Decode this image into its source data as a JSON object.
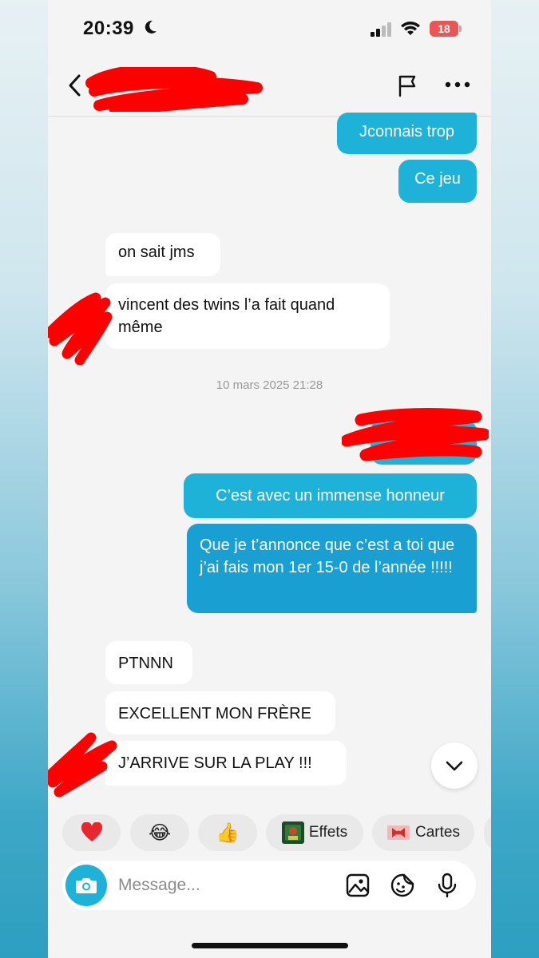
{
  "status_bar": {
    "time": "20:39",
    "battery": "18",
    "moon": "moon-icon",
    "signal": "cellular-signal-icon",
    "wifi": "wifi-icon"
  },
  "header": {
    "back_icon": "chevron-left-icon",
    "flag_icon": "flag-icon",
    "more_icon": "more-dots-icon"
  },
  "messages": [
    {
      "side": "out",
      "text": "Jconnais trop"
    },
    {
      "side": "out",
      "text": "Ce jeu"
    },
    {
      "side": "in",
      "text": "on sait jms"
    },
    {
      "side": "in",
      "text": "vincent des twins l’a fait quand même"
    },
    {
      "side": "out",
      "text": "C’est avec un immense honneur"
    },
    {
      "side": "out",
      "text": "Que je t’annonce que c’est a toi que j’ai fais mon 1er 15-0 de l’année !!!!!"
    },
    {
      "side": "in",
      "text": "PTNNN"
    },
    {
      "side": "in",
      "text": "EXCELLENT MON FRÈRE"
    },
    {
      "side": "in",
      "text": "J’ARRIVE SUR LA PLAY !!!"
    }
  ],
  "timestamp": "10 mars 2025 21:28",
  "quick_reactions": [
    {
      "emoji": "❤️",
      "icon": "heart-icon"
    },
    {
      "emoji": "😂",
      "icon": "laughing-face-icon"
    },
    {
      "emoji": "👍",
      "icon": "thumbs-up-icon"
    },
    {
      "label": "Effets",
      "icon": "effects-thumbnail-icon"
    },
    {
      "label": "Cartes",
      "icon": "gift-card-icon"
    }
  ],
  "composer": {
    "placeholder": "Message...",
    "camera_icon": "camera-icon",
    "gallery_icon": "image-icon",
    "sticker_icon": "sticker-icon",
    "mic_icon": "microphone-icon"
  },
  "colors": {
    "outgoing": "#1eb2d8",
    "outgoing_alt": "#1a9fd3",
    "incoming": "#ffffff",
    "background": "#f4f4f4",
    "redaction": "#ff0000"
  }
}
